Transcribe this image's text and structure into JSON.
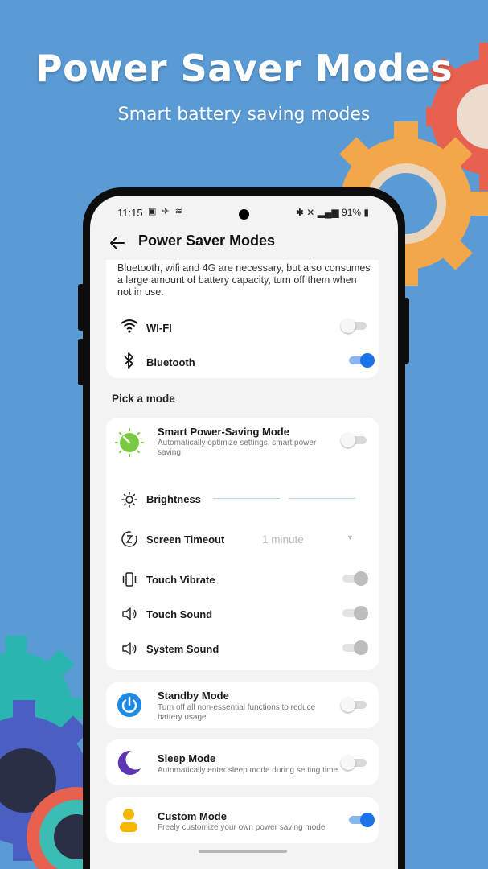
{
  "promo": {
    "headline": "Power Saver Modes",
    "subline": "Smart battery saving modes"
  },
  "status_bar": {
    "time": "11:15",
    "battery": "91%"
  },
  "app_bar": {
    "title": "Power Saver Modes"
  },
  "network_card": {
    "description": "Bluetooth, wifi and 4G are necessary, but also consumes a large amount of battery capacity, turn off them when not in use.",
    "items": [
      {
        "label": "WI-FI",
        "icon": "wifi-icon",
        "state": "off"
      },
      {
        "label": "Bluetooth",
        "icon": "bluetooth-icon",
        "state": "on"
      }
    ]
  },
  "mode_section": {
    "title": "Pick a mode"
  },
  "smart_mode": {
    "title": "Smart Power-Saving Mode",
    "subtitle": "Automatically optimize settings, smart power saving",
    "state": "off",
    "settings": {
      "brightness_label": "Brightness",
      "screen_timeout_label": "Screen Timeout",
      "screen_timeout_value": "1 minute",
      "touch_vibrate_label": "Touch Vibrate",
      "touch_sound_label": "Touch Sound",
      "system_sound_label": "System Sound"
    }
  },
  "modes": [
    {
      "title": "Standby Mode",
      "subtitle": "Turn off all non-essential functions to reduce battery usage",
      "state": "off",
      "icon": "power-icon"
    },
    {
      "title": "Sleep Mode",
      "subtitle": "Automatically enter sleep mode during setting time",
      "state": "off",
      "icon": "moon-icon"
    },
    {
      "title": "Custom Mode",
      "subtitle": "Freely customize your own power saving mode",
      "state": "on",
      "icon": "person-icon"
    }
  ],
  "colors": {
    "background": "#5b9bd5",
    "accent": "#1a73e8",
    "smart_green": "#7ac943",
    "standby_blue": "#1e88e5",
    "sleep_purple": "#5e35b1",
    "custom_yellow": "#f5b800"
  }
}
